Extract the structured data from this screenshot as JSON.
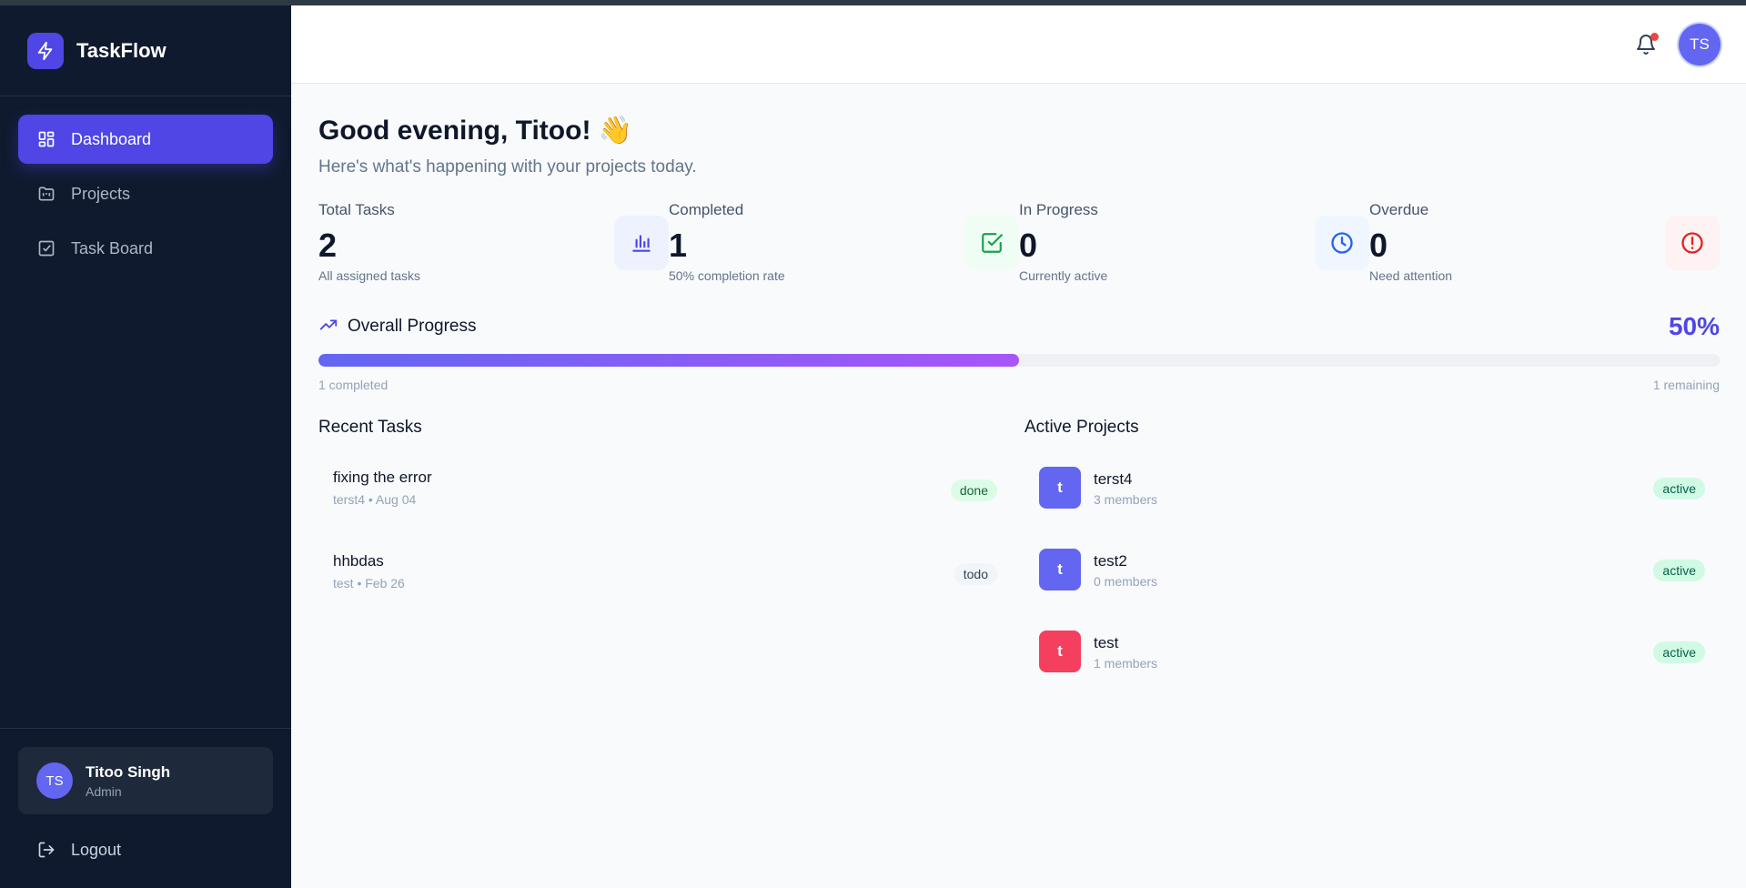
{
  "app": {
    "name": "TaskFlow"
  },
  "sidebar": {
    "items": [
      {
        "label": "Dashboard",
        "icon": "dashboard-icon",
        "active": true
      },
      {
        "label": "Projects",
        "icon": "projects-icon",
        "active": false
      },
      {
        "label": "Task Board",
        "icon": "task-board-icon",
        "active": false
      }
    ],
    "user": {
      "initials": "TS",
      "name": "Titoo Singh",
      "role": "Admin"
    },
    "logout_label": "Logout"
  },
  "header": {
    "avatar_initials": "TS",
    "notification_dot": true
  },
  "greeting": {
    "title": "Good evening, Titoo! 👋",
    "subtitle": "Here's what's happening with your projects today."
  },
  "stats": [
    {
      "label": "Total Tasks",
      "value": "2",
      "sub": "All assigned tasks",
      "icon": "bar-chart-icon",
      "color": "#4f46e5",
      "bg": "#eef2ff"
    },
    {
      "label": "Completed",
      "value": "1",
      "sub": "50% completion rate",
      "icon": "check-square-icon",
      "color": "#16a34a",
      "bg": "#f0fdf4"
    },
    {
      "label": "In Progress",
      "value": "0",
      "sub": "Currently active",
      "icon": "clock-icon",
      "color": "#2563eb",
      "bg": "#eff6ff"
    },
    {
      "label": "Overdue",
      "value": "0",
      "sub": "Need attention",
      "icon": "alert-circle-icon",
      "color": "#dc2626",
      "bg": "#fef2f2"
    }
  ],
  "progress": {
    "title": "Overall Progress",
    "percent_label": "50%",
    "fraction": 0.5,
    "completed_label": "1 completed",
    "remaining_label": "1 remaining"
  },
  "recent_tasks": {
    "title": "Recent Tasks",
    "items": [
      {
        "title": "fixing the error",
        "meta": "terst4 • Aug 04",
        "status": "done"
      },
      {
        "title": "hhbdas",
        "meta": "test • Feb 26",
        "status": "todo"
      }
    ]
  },
  "active_projects": {
    "title": "Active Projects",
    "items": [
      {
        "initial": "t",
        "name": "terst4",
        "members": "3 members",
        "status": "active",
        "color": "#6366f1"
      },
      {
        "initial": "t",
        "name": "test2",
        "members": "0 members",
        "status": "active",
        "color": "#6366f1"
      },
      {
        "initial": "t",
        "name": "test",
        "members": "1 members",
        "status": "active",
        "color": "#f43f5e"
      }
    ]
  },
  "colors": {
    "accent": "#4f46e5",
    "sidebar_bg": "#101a2e"
  }
}
